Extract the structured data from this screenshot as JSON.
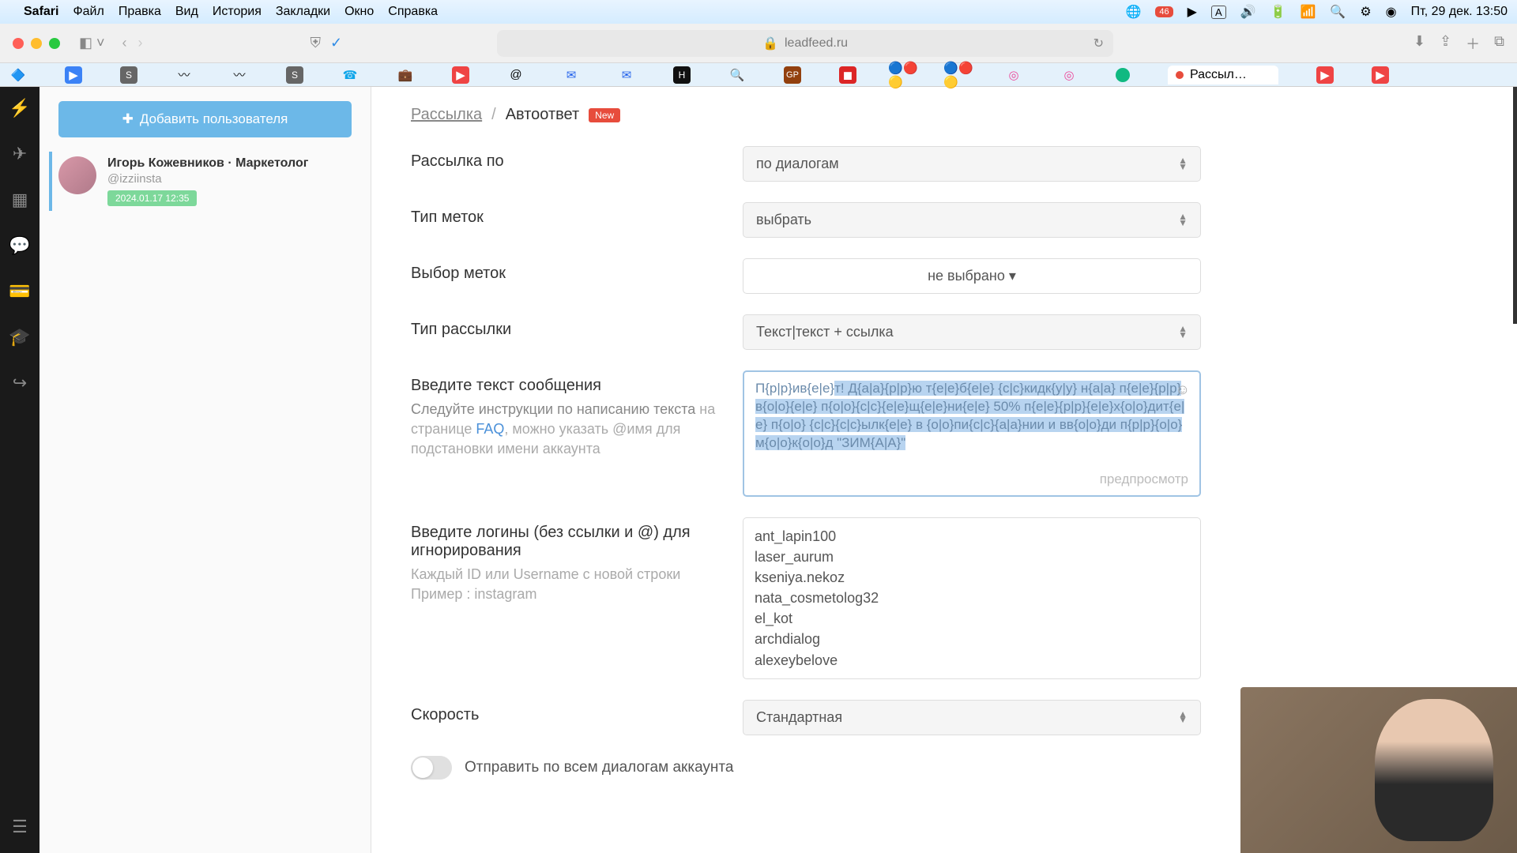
{
  "menubar": {
    "app": "Safari",
    "items": [
      "Файл",
      "Правка",
      "Вид",
      "История",
      "Закладки",
      "Окно",
      "Справка"
    ],
    "status_badge": "46",
    "lang": "А",
    "datetime": "Пт, 29 дек. 13:50"
  },
  "browser": {
    "url": "leadfeed.ru",
    "active_tab": "Рассыл…"
  },
  "sidebar_user": {
    "add_button": "Добавить пользователя",
    "name": "Игорь Кожевников · Маркетолог",
    "handle": "@izziinsta",
    "date": "2024.01.17 12:35"
  },
  "breadcrumb": {
    "root": "Рассылка",
    "sep": "/",
    "current": "Автоответ",
    "badge": "New"
  },
  "form": {
    "send_by": {
      "label": "Рассылка по",
      "value": "по диалогам"
    },
    "label_type": {
      "label": "Тип меток",
      "value": "выбрать"
    },
    "label_select": {
      "label": "Выбор меток",
      "value": "не выбрано"
    },
    "send_type": {
      "label": "Тип рассылки",
      "value": "Текст|текст + ссылка"
    },
    "message": {
      "label": "Введите текст сообщения",
      "hint_bold": "Следуйте инструкции по написанию текста",
      "hint_rest": " на странице ",
      "faq": "FAQ",
      "hint_tail": ", можно указать @имя для подстановки имени аккаунта",
      "text_prefix": "П{р|р}ив{е|е}",
      "text_selected": "т! Д{а|а}{р|р}ю т{е|е}б{е|е} {с|с}кидк{у|у} н{а|а} п{е|е}{р|р}в{о|о}{е|е} п{о|о}{с|с}{е|е}щ{е|е}ни{е|е} 50% п{е|е}{р|р}{е|е}х{о|о}дит{е|е} п{о|о} {с|с}{с|с}ылк{е|е} в {о|о}пи{с|с}{а|а}нии и вв{о|о}ди п{р|р}{о|о}м{о|о}к{о|о}д \"ЗИМ{А|А}\"",
      "preview": "предпросмотр"
    },
    "ignore_logins": {
      "label": "Введите логины (без ссылки и @) для игнорирования",
      "hint1": "Каждый ID или Username с новой строки",
      "hint2": "Пример : instagram",
      "values": [
        "ant_lapin100",
        "laser_aurum",
        "kseniya.nekoz",
        "nata_cosmetolog32",
        "el_kot",
        "archdialog",
        "alexeybelove"
      ]
    },
    "speed": {
      "label": "Скорость",
      "value": "Стандартная"
    },
    "toggle_all": "Отправить по всем диалогам аккаунта"
  }
}
